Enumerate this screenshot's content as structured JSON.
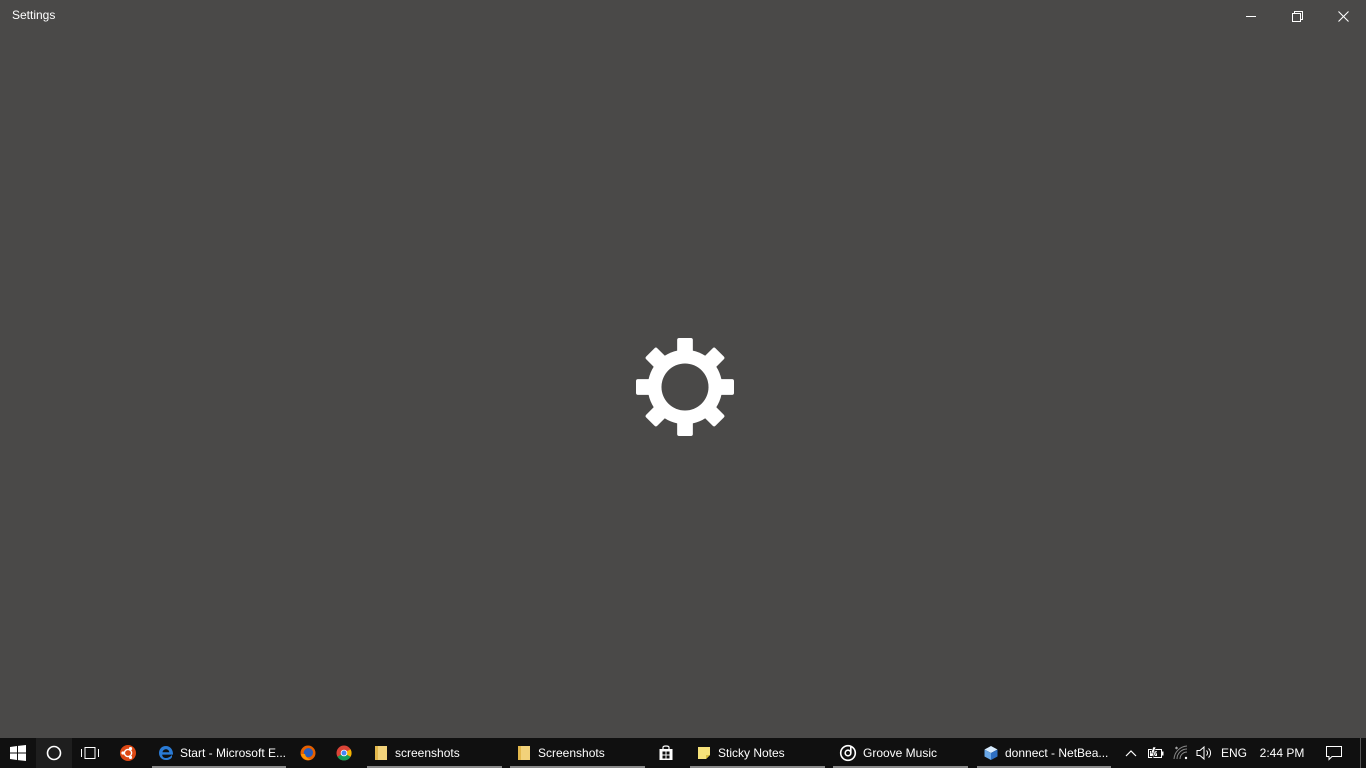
{
  "window": {
    "title": "Settings",
    "background": "#4a4948",
    "controls": {
      "minimize_icon": "minimize-icon",
      "restore_icon": "restore-icon",
      "close_icon": "close-icon"
    },
    "splash_icon": "gear-icon"
  },
  "taskbar": {
    "background": "#101010",
    "start_icon": "windows-logo-icon",
    "cortana_icon": "cortana-circle-icon",
    "task_view_icon": "task-view-icon",
    "pinned": [
      {
        "icon": "ubuntu-icon"
      },
      {
        "icon": "firefox-icon"
      },
      {
        "icon": "chrome-icon"
      },
      {
        "icon": "store-icon"
      }
    ],
    "apps": [
      {
        "label": "Start - Microsoft E...",
        "icon": "edge-icon"
      },
      {
        "label": "screenshots",
        "icon": "folder-icon"
      },
      {
        "label": "Screenshots",
        "icon": "folder-icon"
      },
      {
        "label": "Sticky Notes",
        "icon": "sticky-notes-icon"
      },
      {
        "label": "Groove Music",
        "icon": "groove-music-icon"
      },
      {
        "label": "donnect - NetBea...",
        "icon": "netbeans-icon"
      }
    ],
    "tray": {
      "chevron_icon": "chevron-up-icon",
      "battery_icon": "battery-icon",
      "wifi_icon": "wifi-icon",
      "volume_icon": "volume-icon",
      "language": "ENG",
      "time": "2:44 PM",
      "action_center_icon": "action-center-icon"
    }
  }
}
